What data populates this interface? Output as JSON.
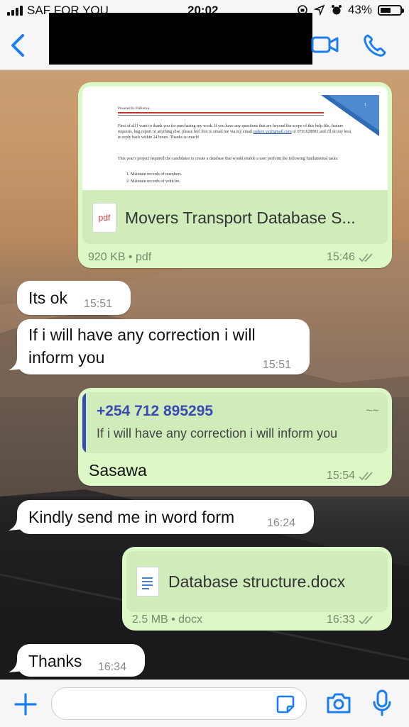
{
  "status_bar": {
    "carrier": "SAF FOR YOU",
    "time": "20:02",
    "battery": "43%"
  },
  "header": {
    "contact_name": ""
  },
  "messages": [
    {
      "id": "m1",
      "direction": "outgoing",
      "type": "document",
      "preview_header": "Powered by PsiKenya",
      "preview_page_number": "1",
      "preview_para1": "First of all I want to thank you for purchasing my work. If you have any questions that are beyond the scope of this help file, feature requests, bug report or anything else, please feel free to email me via my email",
      "preview_email": "psiken ya@gmail.com",
      "preview_para1_end": "or 0701628981 and i'll do my best to reply back within 24 hours. Thanks so much!",
      "preview_para2": "This year's project required the candidates to create a database that would enable a user perform the following fundamental tasks:",
      "preview_list": [
        "1.   Maintain records of members.",
        "2.   Maintain records of vehicles."
      ],
      "file_icon": "pdf",
      "file_name": "Movers Transport Database S...",
      "file_meta": "920 KB • pdf",
      "time": "15:46"
    },
    {
      "id": "m2",
      "direction": "incoming",
      "text": "Its ok",
      "time": "15:51"
    },
    {
      "id": "m3",
      "direction": "incoming",
      "text_line1": "If i will have any correction i will",
      "text_line2": "inform you",
      "time": "15:51"
    },
    {
      "id": "m4",
      "direction": "outgoing",
      "type": "reply",
      "quote_sender": "+254 712 895295",
      "quote_text": "If i will have any correction i will inform you",
      "text": "Sasawa",
      "time": "15:54"
    },
    {
      "id": "m5",
      "direction": "incoming",
      "text": "Kindly send me in word form",
      "time": "16:24"
    },
    {
      "id": "m6",
      "direction": "outgoing",
      "type": "document",
      "file_name": "Database structure.docx",
      "file_meta": "2.5 MB • docx",
      "time": "16:33"
    },
    {
      "id": "m7",
      "direction": "incoming",
      "text": "Thanks",
      "time": "16:34"
    }
  ],
  "input": {
    "placeholder": ""
  },
  "colors": {
    "accent": "#1a7ef2",
    "outgoing_bubble": "#dcf8c6",
    "incoming_bubble": "#ffffff",
    "quote_accent": "#3a4ab5"
  },
  "icons": [
    "back-chevron-icon",
    "video-call-icon",
    "phone-call-icon",
    "plus-icon",
    "sticker-icon",
    "camera-icon",
    "microphone-icon",
    "read-receipt-icon"
  ]
}
